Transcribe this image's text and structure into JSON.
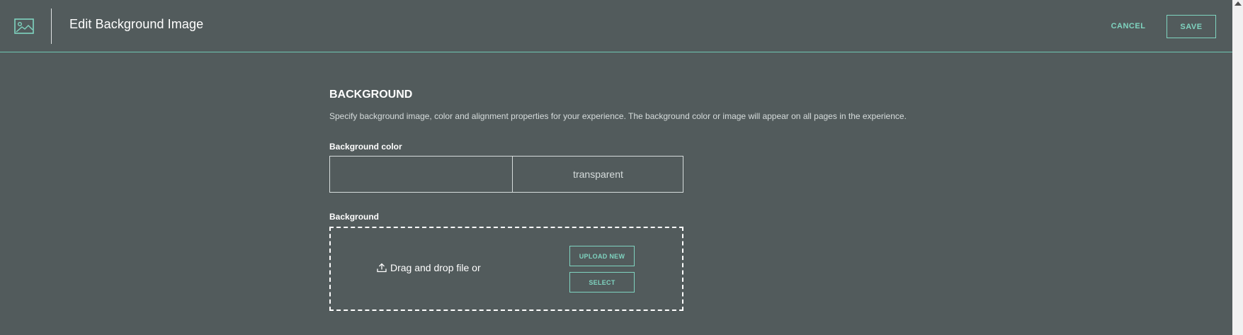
{
  "header": {
    "title": "Edit Background Image",
    "icon": "image-icon",
    "cancel_label": "CANCEL",
    "save_label": "SAVE"
  },
  "section": {
    "title": "BACKGROUND",
    "description": "Specify background image, color and alignment properties for your experience. The background color or image will appear on all pages in the experience."
  },
  "background_color": {
    "label": "Background color",
    "value": "transparent"
  },
  "background": {
    "label": "Background",
    "drag_text": "Drag and drop file or",
    "upload_icon": "upload-icon",
    "upload_label": "UPLOAD NEW",
    "select_label": "SELECT"
  },
  "colors": {
    "page_bg": "#525b5c",
    "accent": "#7fd4c0",
    "text": "#ffffff",
    "muted": "#d6dcdc"
  }
}
